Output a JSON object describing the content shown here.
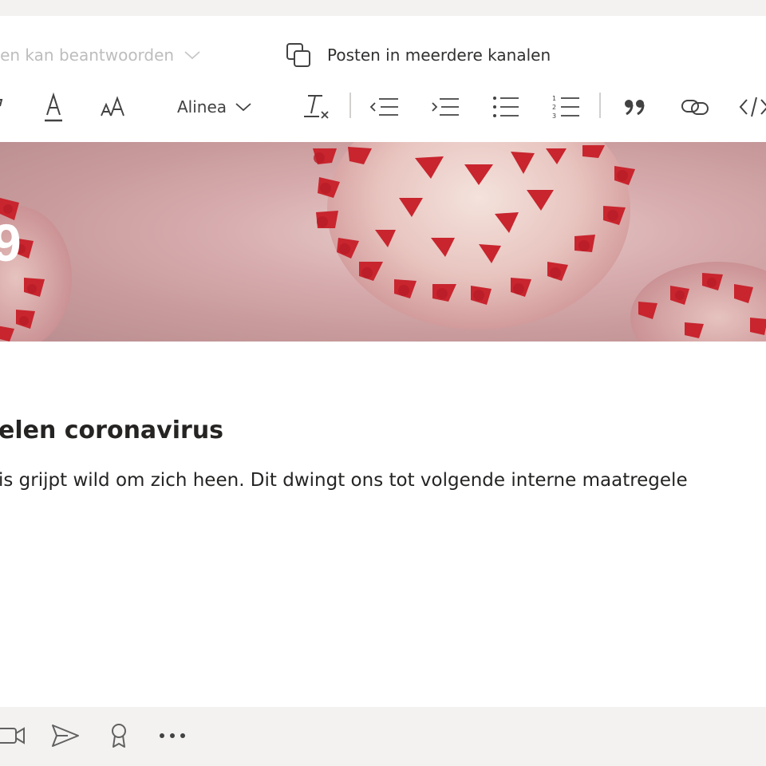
{
  "compose": {
    "reply_setting_label": "reen kan beantwoorden",
    "multi_post_label": "Posten in meerdere kanalen",
    "paragraph_style": "Alinea"
  },
  "toolbar": {
    "icons": [
      "font-color-icon",
      "font-size-icon",
      "paragraph-style-select",
      "clear-formatting-icon",
      "decrease-indent-icon",
      "increase-indent-icon",
      "bulleted-list-icon",
      "numbered-list-icon",
      "quote-icon",
      "link-icon",
      "code-icon"
    ]
  },
  "banner": {
    "title_fragment": "9"
  },
  "post": {
    "headline": "elen coronavirus",
    "body": "is grijpt wild om zich heen. Dit dwingt ons tot volgende interne maatregele"
  },
  "actions": {
    "icons": [
      "meet-now-icon",
      "send-icon",
      "praise-icon",
      "more-options-icon"
    ]
  },
  "colors": {
    "background": "#f3f2f1",
    "card": "#ffffff",
    "text": "#252423",
    "muted_text": "#bdbdbd",
    "virus_red": "#c8252e"
  }
}
